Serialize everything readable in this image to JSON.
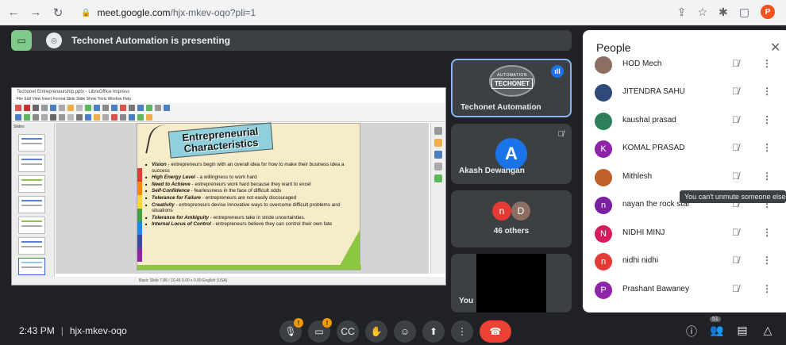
{
  "browser": {
    "url_host": "meet.google.com",
    "url_path": "/hjx-mkev-oqo?pli=1",
    "profile_initial": "P"
  },
  "presenting_bar": {
    "text": "Techonet Automation is presenting"
  },
  "presentation": {
    "window_title": "Techonet Entrepreneurship.pptx - LibreOffice Impress",
    "menu": "File  Edit  View  Insert  Format  Slide  Slide Show  Tools  Window  Help",
    "slides_label": "Slides",
    "status_text": "Basic Slide     7.86 / 10.46     0.00 x 0.00     English (USA)",
    "slide": {
      "title_line1": "Entrepreneurial",
      "title_line2": "Characteristics",
      "items": [
        {
          "term": "Vision",
          "text": " - entrepreneurs begin with an overall idea for how to make their business idea a success"
        },
        {
          "term": "High Energy Level",
          "text": " - a willingness to work hard"
        },
        {
          "term": "Need to Achieve",
          "text": " - entrepreneurs work hard because they want to excel"
        },
        {
          "term": "Self-Confidence",
          "text": " - fearlessness in the face of difficult odds"
        },
        {
          "term": "Tolerance for Failure",
          "text": " - entrepreneurs are not easily discouraged"
        },
        {
          "term": "Creativity",
          "text": " - entrepreneurs devise innovative ways to overcome difficult problems and situations"
        },
        {
          "term": "Tolerance for Ambiguity",
          "text": " - entrepreneurs take in stride uncertainties."
        },
        {
          "term": "Internal Locus of Control",
          "text": " - entrepreneurs believe they can control their own fate"
        }
      ]
    }
  },
  "tiles": [
    {
      "name": "Techonet Automation",
      "logo_top": "AUTOMATION",
      "logo_main": "TECHONET"
    },
    {
      "name": "Akash Dewangan",
      "initial": "A"
    },
    {
      "name": "46 others",
      "av1": "n",
      "av2": "D"
    },
    {
      "name": "You"
    }
  ],
  "people_panel": {
    "title": "People",
    "participants": [
      {
        "name": "HOD Mech",
        "initial": "",
        "color": "#8d6e63"
      },
      {
        "name": "JITENDRA SAHU",
        "initial": "",
        "color": "#2f4a7a"
      },
      {
        "name": "kaushal prasad",
        "initial": "",
        "color": "#2e7d5b"
      },
      {
        "name": "KOMAL PRASAD",
        "initial": "K",
        "color": "#8e24aa"
      },
      {
        "name": "Mithlesh",
        "initial": "",
        "color": "#c0602a"
      },
      {
        "name": "nayan the rock star",
        "initial": "n",
        "color": "#7b1fa2"
      },
      {
        "name": "NIDHI MINJ",
        "initial": "N",
        "color": "#d81b60"
      },
      {
        "name": "nidhi nidhi",
        "initial": "n",
        "color": "#e53935"
      },
      {
        "name": "Prashant Bawaney",
        "initial": "P",
        "color": "#8e24aa"
      }
    ],
    "tooltip": "You can't unmute someone else"
  },
  "bottom_bar": {
    "time": "2:43 PM",
    "separator": "|",
    "meeting_code": "hjx-mkev-oqo",
    "participant_count": "51"
  }
}
